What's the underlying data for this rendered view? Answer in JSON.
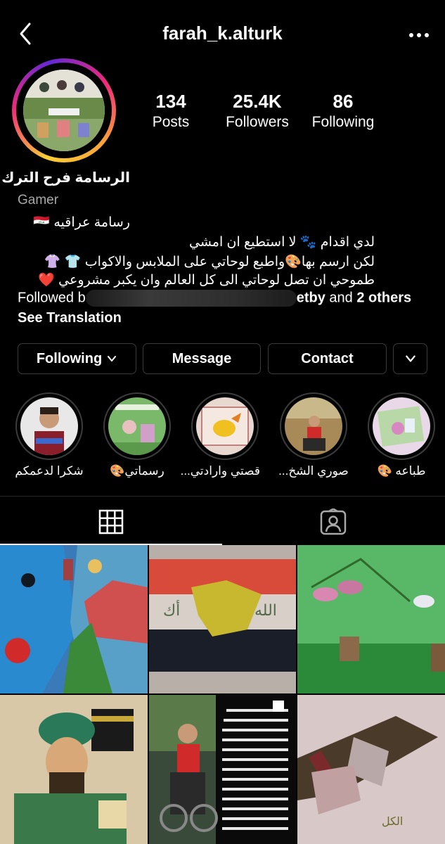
{
  "header": {
    "username": "farah_k.alturk",
    "back_icon": "chevron-left-icon",
    "more_icon": "more-horizontal-icon"
  },
  "profile": {
    "stats": {
      "posts": {
        "value": "134",
        "label": "Posts"
      },
      "followers": {
        "value": "25.4K",
        "label": "Followers"
      },
      "following": {
        "value": "86",
        "label": "Following"
      }
    },
    "display_name": "الرسامة فرح الترك",
    "category": "Gamer",
    "bio_lines": [
      "رسامة عراقيه 🇮🇶",
      "لدي اقدام 🐾 لا استطيع ان امشي",
      "لكن ارسم بها🎨واطبع لوحاتي على الملابس والاكواب 👕 👚",
      "طموحي ان تصل لوحاتي الى كل العالم وان يكبر مشروعي ❤️"
    ],
    "followed_by_prefix": "Followed b",
    "followed_by_suffix_name": "etby",
    "followed_by_and": " and ",
    "followed_by_others": "2 others",
    "see_translation": "See Translation"
  },
  "actions": {
    "following_label": "Following",
    "message_label": "Message",
    "contact_label": "Contact"
  },
  "highlights": [
    {
      "label": "شكرا لدعمكم"
    },
    {
      "label": "رسماتي🎨"
    },
    {
      "label": "قصتي وارادتي..."
    },
    {
      "label": "صوري الشخ..."
    },
    {
      "label": "طباعه 🎨"
    }
  ],
  "tabs": {
    "grid_icon": "grid-icon",
    "tagged_icon": "tagged-person-icon"
  },
  "colors": {
    "background": "#000000",
    "border": "#3a3a3a",
    "secondary_text": "#a8a8a8"
  }
}
